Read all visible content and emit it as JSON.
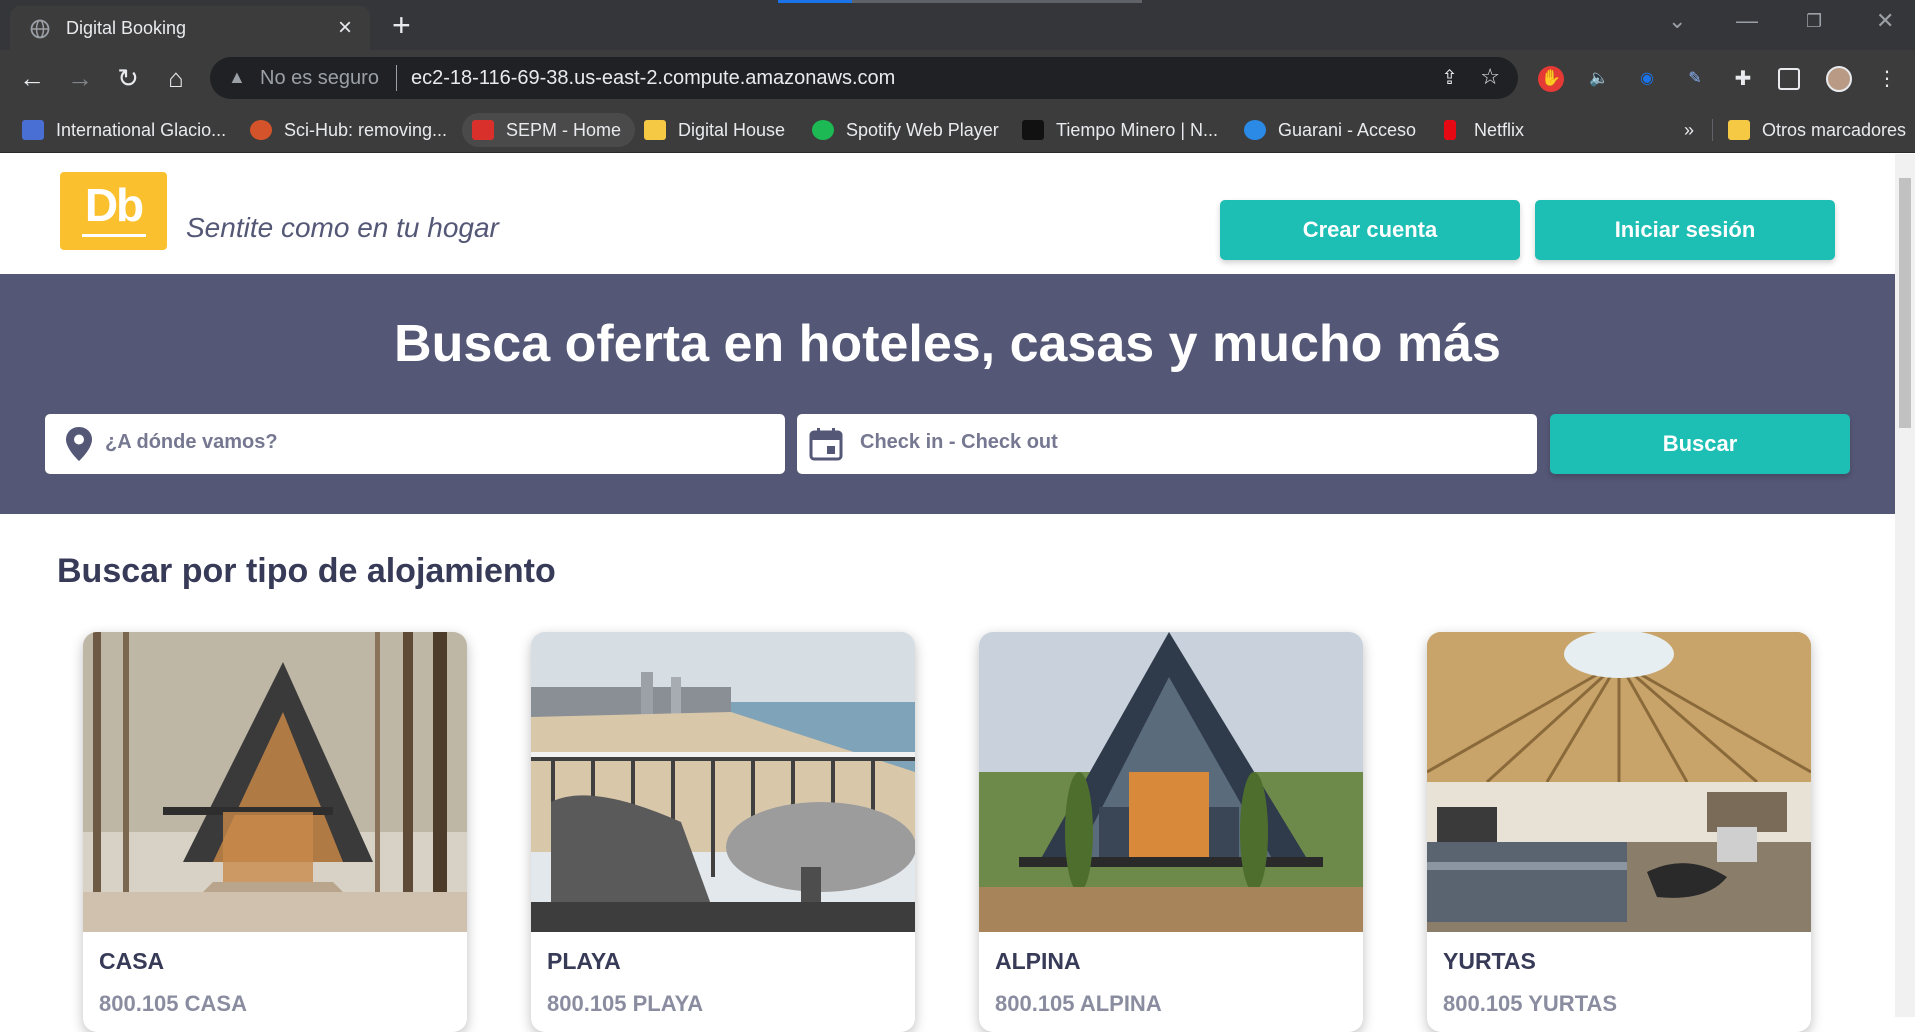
{
  "browser": {
    "tab_title": "Digital Booking",
    "insecure_label": "No es seguro",
    "url": "ec2-18-116-69-38.us-east-2.compute.amazonaws.com",
    "bookmarks": [
      {
        "label": "International Glacio...",
        "icon_color": "#4a6fd4"
      },
      {
        "label": "Sci-Hub: removing...",
        "icon_color": "#d4532a"
      },
      {
        "label": "SEPM - Home",
        "icon_color": "#d9302c"
      },
      {
        "label": "Digital House",
        "icon_color": "#f6c945"
      },
      {
        "label": "Spotify Web Player",
        "icon_color": "#1db954"
      },
      {
        "label": "Tiempo Minero | N...",
        "icon_color": "#111111"
      },
      {
        "label": "Guarani - Acceso",
        "icon_color": "#2b8ae6"
      },
      {
        "label": "Netflix",
        "icon_color": "#e50914"
      }
    ],
    "other_bookmarks": "Otros marcadores",
    "more_chevron": "»"
  },
  "header": {
    "logo_text": "Db",
    "slogan": "Sentite como en tu hogar",
    "create_account": "Crear cuenta",
    "login": "Iniciar sesión"
  },
  "hero": {
    "title": "Busca oferta en hoteles, casas y mucho más",
    "destination_placeholder": "¿A dónde vamos?",
    "dates_placeholder": "Check in - Check out",
    "search_button": "Buscar"
  },
  "categories": {
    "title": "Buscar por tipo de alojamiento",
    "items": [
      {
        "name": "CASA",
        "count": "800.105 CASA"
      },
      {
        "name": "PLAYA",
        "count": "800.105 PLAYA"
      },
      {
        "name": "ALPINA",
        "count": "800.105 ALPINA"
      },
      {
        "name": "YURTAS",
        "count": "800.105 YURTAS"
      }
    ]
  },
  "colors": {
    "primary": "#1dbeb4",
    "secondary": "#545776",
    "logo": "#fbc02d",
    "dark_text": "#383b58"
  }
}
